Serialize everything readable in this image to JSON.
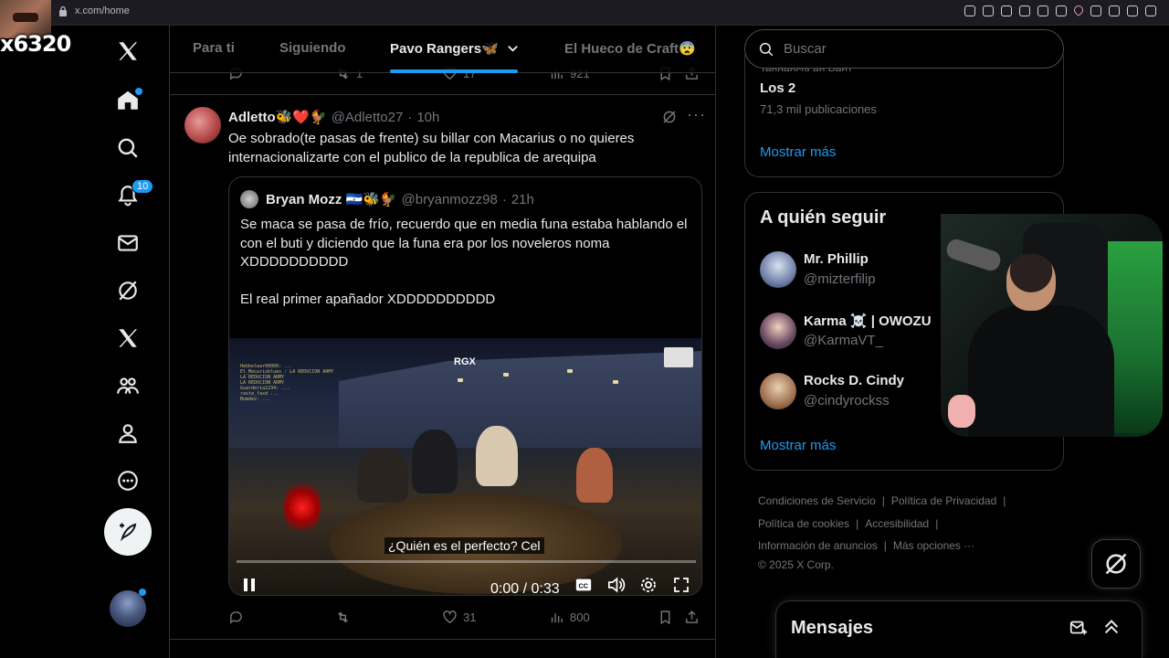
{
  "browser": {
    "url": "x.com/home"
  },
  "stream": {
    "overlay_text": "x6320"
  },
  "nav": {
    "notification_count": "10"
  },
  "tabs": [
    {
      "label": "Para ti"
    },
    {
      "label": "Siguiendo"
    },
    {
      "label": "Pavo Rangers🦋"
    },
    {
      "label": "El Hueco de Craft😨"
    }
  ],
  "prev_tweet": {
    "retweets": "1",
    "likes": "17",
    "views": "921"
  },
  "tweet": {
    "name": "Adletto🐝❤️🐓",
    "handle": "@Adletto27",
    "time": "10h",
    "text": "Oe sobrado(te pasas de frente) su billar con Macarius o no quieres internacionalizarte con el publico de la republica de arequipa",
    "replies": "",
    "retweets": "",
    "likes": "31",
    "views": "800"
  },
  "quote": {
    "name": "Bryan Mozz 🇸🇻🐝🐓",
    "handle": "@bryanmozz98",
    "time": "21h",
    "text": "Se maca se pasa de frío, recuerdo que en media funa estaba hablando el con el buti y diciendo que la funa era por los noveleros noma XDDDDDDDDDD\n\nEl real primer apañador XDDDDDDDDDD"
  },
  "video": {
    "logo": "RGX",
    "subtitle": "¿Quién es el perfecto? Cel",
    "time": "0:00 / 0:33",
    "progress": 0.0,
    "chat_lines": [
      "Hebbelwar00000: ...",
      "El_Macarioblues : LA REDUCION ARMY",
      "LA REDUCION ARMY",
      "LA REDUCION ARMY",
      "Guarderia1234: ...",
      "rasta_fasd ...",
      "Bomdev: ..."
    ]
  },
  "search": {
    "placeholder": "Buscar"
  },
  "trends": {
    "cut_label": "Tendencia en Perú",
    "name": "Los 2",
    "count": "71,3 mil publicaciones",
    "show_more": "Mostrar más"
  },
  "who_to_follow": {
    "title": "A quién seguir",
    "items": [
      {
        "name": "Mr. Phillip",
        "handle": "@mizterfilip"
      },
      {
        "name": "Karma ☠️ | OWOZU",
        "handle": "@KarmaVT_"
      },
      {
        "name": "Rocks D. Cindy",
        "handle": "@cindyrockss"
      }
    ],
    "show_more": "Mostrar más"
  },
  "footer": {
    "terms": "Condiciones de Servicio",
    "privacy": "Política de Privacidad",
    "cookies": "Política de cookies",
    "accessibility": "Accesibilidad",
    "ads": "Información de anuncios",
    "more": "Más opciones ···",
    "copyright": "© 2025 X Corp."
  },
  "messages": {
    "title": "Mensajes"
  },
  "colors": {
    "accent": "#1d9bf0",
    "text": "#e7e9ea",
    "muted": "#71767b",
    "border": "#2f3336"
  }
}
